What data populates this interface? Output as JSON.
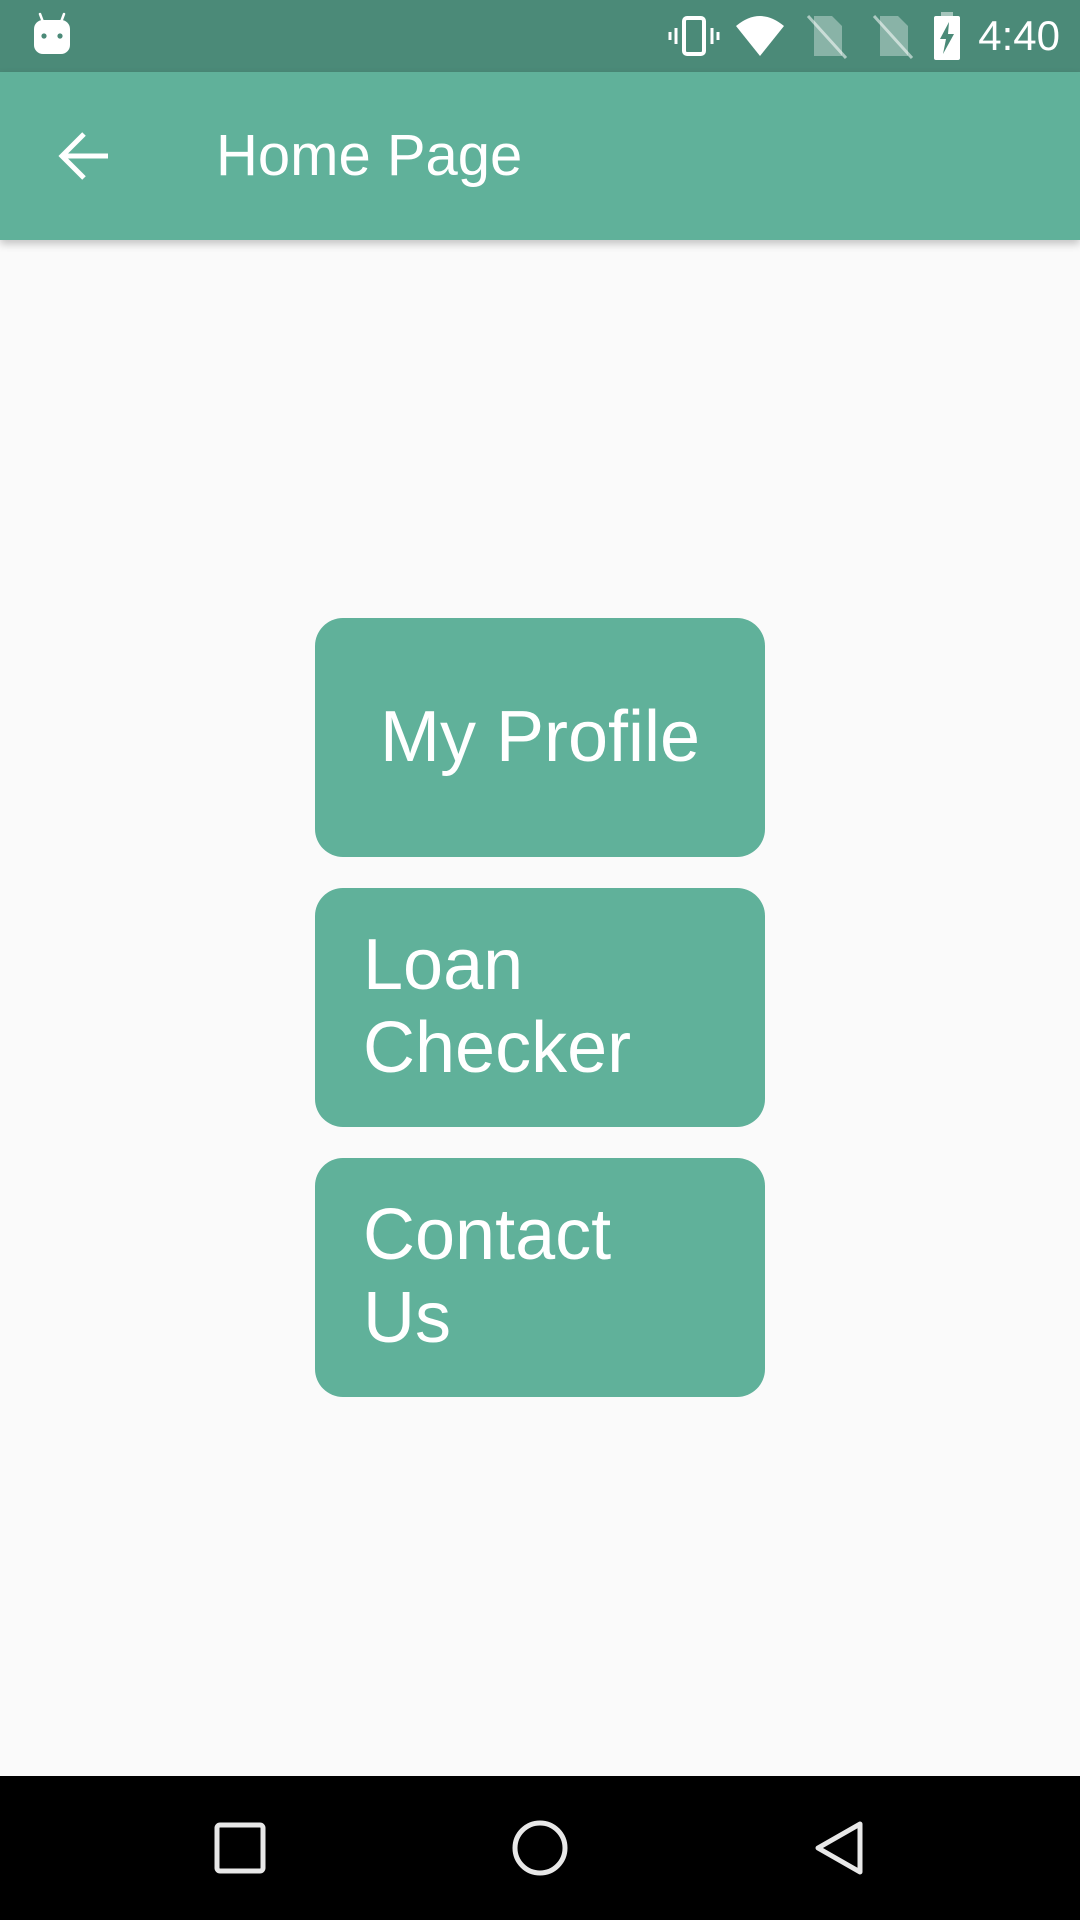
{
  "status_bar": {
    "time": "4:40",
    "icons": [
      "android-notification-icon",
      "vibrate-icon",
      "wifi-icon",
      "no-sim-icon",
      "no-sim-icon",
      "battery-charging-icon"
    ]
  },
  "app_bar": {
    "title": "Home Page",
    "back_icon": "arrow-back-icon"
  },
  "menu": {
    "buttons": [
      {
        "label": "My Profile"
      },
      {
        "label": "Loan Checker"
      },
      {
        "label": "Contact Us"
      }
    ]
  },
  "nav_bar": {
    "icons": [
      "recents-icon",
      "home-icon",
      "back-icon"
    ]
  },
  "colors": {
    "primary": "#60b19a",
    "primary_dark": "#4b8a78",
    "background": "#fafafa"
  }
}
